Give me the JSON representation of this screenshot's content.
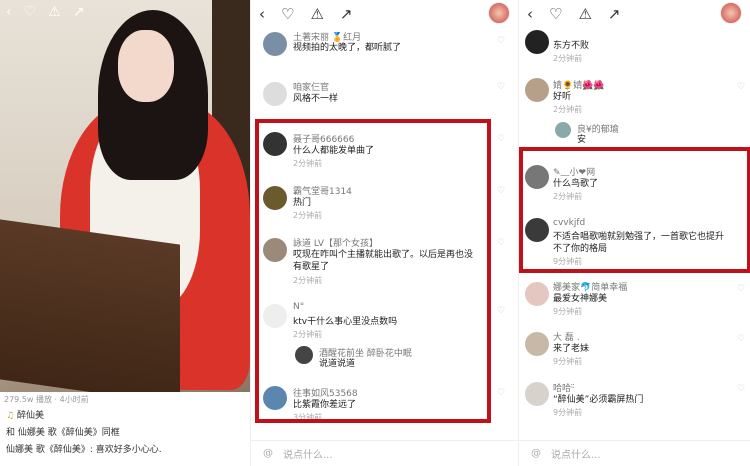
{
  "panel1": {
    "views": "279.5w 播放 · 4小时前",
    "author": "醉仙美",
    "line1": "和 仙娜美 歌《醉仙美》同框",
    "line2": "仙娜美 歌《醉仙美》: 喜欢好多小心心."
  },
  "panel2": {
    "comments": [
      {
        "name": "土著宋丽 🏅红月",
        "text": "视频拍的太晚了，都听腻了",
        "time": ""
      },
      {
        "name": "咱家仨官",
        "text": "风格不一样",
        "time": ""
      },
      {
        "name": "聂子哥666666",
        "text": "什么人都能发单曲了",
        "time": "2分钟前"
      },
      {
        "name": "霸气堂哥1314",
        "text": "热门",
        "time": "2分钟前"
      },
      {
        "name": "詠道 LV【那个女孩】",
        "text": "哎现在咋叫个主播就能出歌了。以后是再也没有歌星了",
        "time": "2分钟前"
      },
      {
        "name": "N°",
        "text": "ktv干什么事心里没点数吗",
        "time": "2分钟前"
      },
      {
        "name": "酒醒花前坐 醉卧花中眠",
        "text": "说道说道",
        "time": ""
      },
      {
        "name": "往事如风53568",
        "text": "比紫霞你差远了",
        "time": "3分钟前"
      }
    ],
    "input_placeholder": "说点什么..."
  },
  "panel3": {
    "comments": [
      {
        "name": "东方不败",
        "text": "",
        "time": "2分钟前"
      },
      {
        "name": "婧🌻婧🌺🌺",
        "text": "好听",
        "time": "2分钟前"
      },
      {
        "name": "良¥的郁瑜",
        "text": "安",
        "time": ""
      },
      {
        "name": "✎﹏小❤网",
        "text": "什么鸟歌了",
        "time": "2分钟前"
      },
      {
        "name": "cvvkjfd",
        "text": "不适合唱歌啪就别勉强了，一首歌它也提升不了你的格局",
        "time": "9分钟前"
      },
      {
        "name": "娜美家🐬简单幸福",
        "text": "最爱女神娜美",
        "time": "9分钟前"
      },
      {
        "name": "大 磊 .",
        "text": "来了老妹",
        "time": "9分钟前"
      },
      {
        "name": "哈哈ᵕ̈",
        "text": "“醉仙美”必须霸屏热门",
        "time": "9分钟前"
      }
    ],
    "input_placeholder": "说点什么..."
  }
}
